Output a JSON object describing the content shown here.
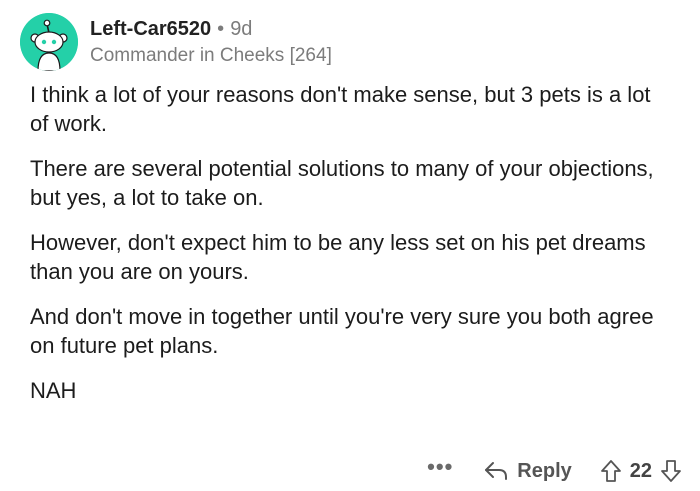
{
  "comment": {
    "author": "Left-Car6520",
    "separator": "•",
    "time_ago": "9d",
    "flair": "Commander in Cheeks [264]",
    "paragraphs": [
      "I think a lot of your reasons don't make sense, but 3 pets is a lot of work.",
      "There are several potential solutions to many of your objections, but yes, a lot to take on.",
      "However, don't expect him to be any less set on his pet dreams than you are on yours.",
      "And don't move in together until you're very sure you both agree on future pet plans.",
      "NAH"
    ],
    "actions": {
      "more": "•••",
      "reply_label": "Reply",
      "score": "22"
    }
  },
  "colors": {
    "avatar_bg": "#24d0a8",
    "text": "#1c1c1c",
    "muted": "#7c7c7c"
  },
  "icons": [
    "reddit-snoo-avatar-icon",
    "reply-arrow-icon",
    "upvote-arrow-icon",
    "downvote-arrow-icon"
  ]
}
